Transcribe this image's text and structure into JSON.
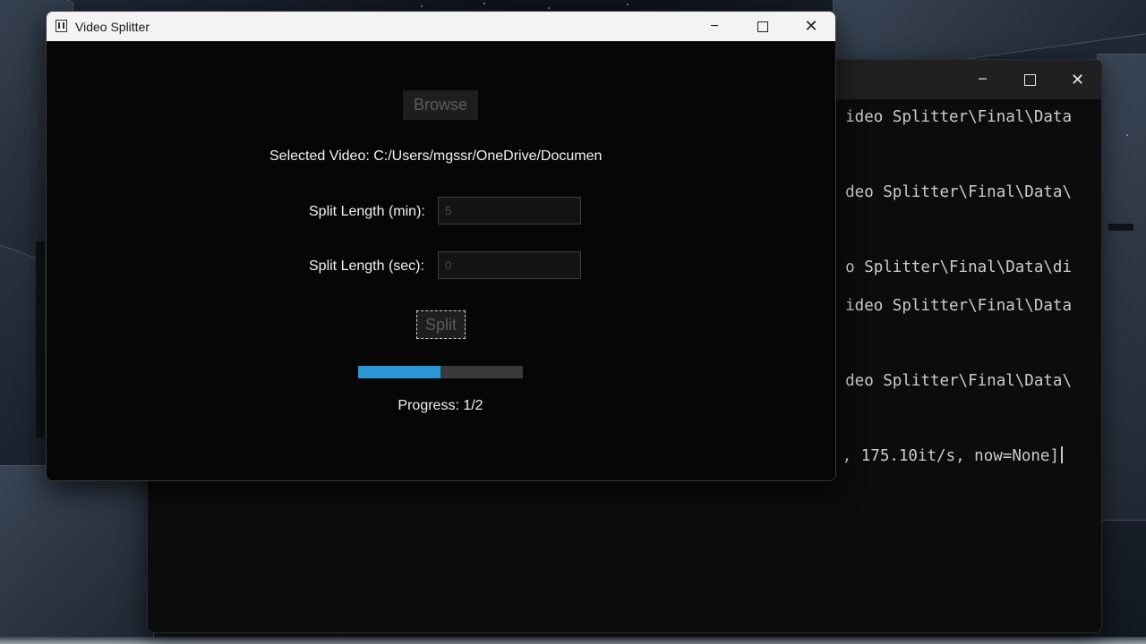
{
  "app_window": {
    "title": "Video Splitter",
    "icon": "film-icon",
    "controls": {
      "minimize": "─",
      "close": "✕"
    }
  },
  "form": {
    "browse_label": "Browse",
    "selected_video_text": "Selected Video: C:/Users/mgssr/OneDrive/Documen",
    "split_min_label": "Split Length (min):",
    "split_min_value": "5",
    "split_sec_label": "Split Length (sec):",
    "split_sec_value": "0",
    "split_label": "Split",
    "progress_fraction": 0.5,
    "progress_text": "Progress: 1/2"
  },
  "terminal": {
    "controls": {
      "minimize": "─",
      "close": "✕"
    },
    "lines": [
      "ideo Splitter\\Final\\Data",
      "deo Splitter\\Final\\Data\\",
      "o Splitter\\Final\\Data\\di",
      "ideo Splitter\\Final\\Data",
      "deo Splitter\\Final\\Data\\",
      ", 175.10it/s, now=None]"
    ]
  },
  "colors": {
    "progress_fill": "#2a97d4",
    "app_background": "#060606",
    "titlebar": "#f3f3f3"
  }
}
